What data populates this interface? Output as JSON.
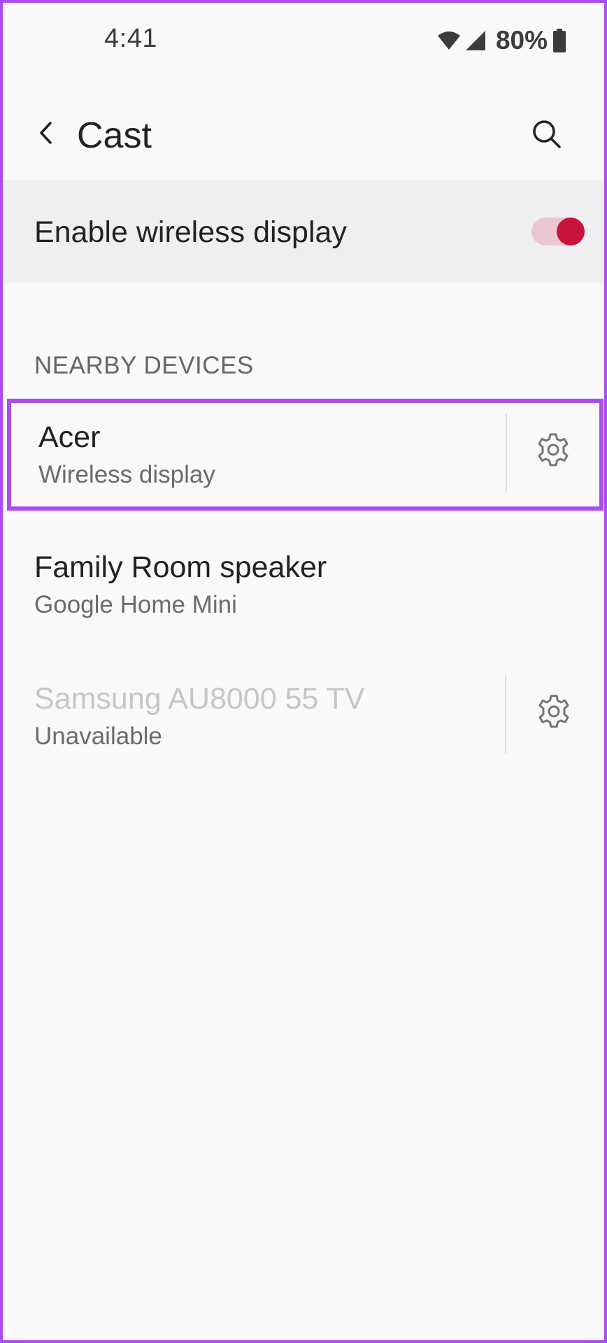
{
  "status_bar": {
    "time": "4:41",
    "battery": "80%"
  },
  "app_bar": {
    "title": "Cast"
  },
  "wireless_display": {
    "label": "Enable wireless display",
    "enabled": true
  },
  "nearby": {
    "header": "NEARBY DEVICES",
    "devices": [
      {
        "name": "Acer",
        "subtitle": "Wireless display",
        "available": true
      },
      {
        "name": "Family Room speaker",
        "subtitle": "Google Home Mini",
        "available": true
      },
      {
        "name": "Samsung AU8000 55 TV",
        "subtitle": "Unavailable",
        "available": false
      }
    ]
  },
  "colors": {
    "accent": "#c8143c",
    "accent_track": "#ebc7d2",
    "highlight_border": "#a94df0",
    "background": "#f9f9fb",
    "toggle_row_bg": "#efeff2"
  },
  "icons": {
    "back": "chevron-left-icon",
    "search": "search-icon",
    "settings": "gear-icon",
    "wifi": "wifi-icon",
    "signal": "signal-icon",
    "battery": "battery-icon"
  }
}
